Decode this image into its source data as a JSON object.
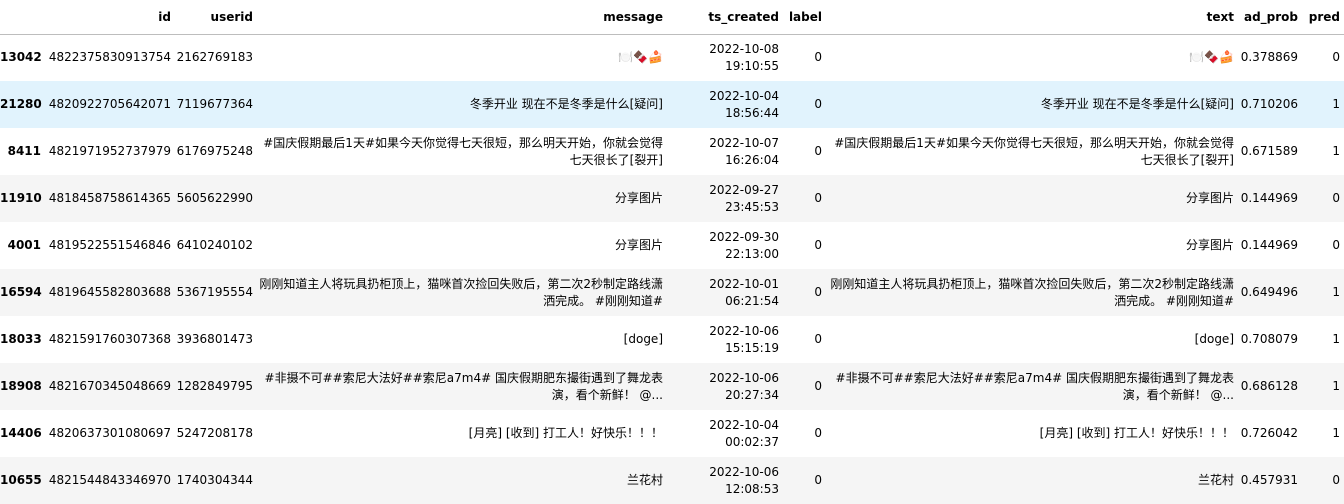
{
  "columns": [
    "",
    "id",
    "userid",
    "message",
    "ts_created",
    "label",
    "text",
    "ad_prob",
    "pred"
  ],
  "rows": [
    {
      "idx": "13042",
      "id": "4822375830913754",
      "userid": "2162769183",
      "message": "🍽️🍫🍰",
      "ts": "2022-10-08\n19:10:55",
      "label": "0",
      "text": "🍽️🍫🍰",
      "ad_prob": "0.378869",
      "pred": "0"
    },
    {
      "idx": "21280",
      "id": "4820922705642071",
      "userid": "7119677364",
      "message": "冬季开业 现在不是冬季是什么[疑问]",
      "ts": "2022-10-04\n18:56:44",
      "label": "0",
      "text": "冬季开业 现在不是冬季是什么[疑问]",
      "ad_prob": "0.710206",
      "pred": "1"
    },
    {
      "idx": "8411",
      "id": "4821971952737979",
      "userid": "6176975248",
      "message": "#国庆假期最后1天#如果今天你觉得七天很短，那么明天开始，你就会觉得七天很长了[裂开]",
      "ts": "2022-10-07\n16:26:04",
      "label": "0",
      "text": "#国庆假期最后1天#如果今天你觉得七天很短，那么明天开始，你就会觉得七天很长了[裂开]",
      "ad_prob": "0.671589",
      "pred": "1"
    },
    {
      "idx": "11910",
      "id": "4818458758614365",
      "userid": "5605622990",
      "message": "分享图片",
      "ts": "2022-09-27\n23:45:53",
      "label": "0",
      "text": "分享图片",
      "ad_prob": "0.144969",
      "pred": "0"
    },
    {
      "idx": "4001",
      "id": "4819522551546846",
      "userid": "6410240102",
      "message": "分享图片",
      "ts": "2022-09-30\n22:13:00",
      "label": "0",
      "text": "分享图片",
      "ad_prob": "0.144969",
      "pred": "0"
    },
    {
      "idx": "16594",
      "id": "4819645582803688",
      "userid": "5367195554",
      "message": "刚刚知道主人将玩具扔柜顶上，猫咪首次捡回失败后，第二次2秒制定路线潇洒完成。 #刚刚知道#",
      "ts": "2022-10-01\n06:21:54",
      "label": "0",
      "text": "刚刚知道主人将玩具扔柜顶上，猫咪首次捡回失败后，第二次2秒制定路线潇洒完成。 #刚刚知道#",
      "ad_prob": "0.649496",
      "pred": "1"
    },
    {
      "idx": "18033",
      "id": "4821591760307368",
      "userid": "3936801473",
      "message": "[doge]",
      "ts": "2022-10-06\n15:15:19",
      "label": "0",
      "text": "[doge]",
      "ad_prob": "0.708079",
      "pred": "1"
    },
    {
      "idx": "18908",
      "id": "4821670345048669",
      "userid": "1282849795",
      "message": "#非摄不可##索尼大法好##索尼a7m4# 国庆假期肥东撮街遇到了舞龙表演，看个新鲜！ @...",
      "ts": "2022-10-06\n20:27:34",
      "label": "0",
      "text": "#非摄不可##索尼大法好##索尼a7m4# 国庆假期肥东撮街遇到了舞龙表演，看个新鲜！ @...",
      "ad_prob": "0.686128",
      "pred": "1"
    },
    {
      "idx": "14406",
      "id": "4820637301080697",
      "userid": "5247208178",
      "message": "[月亮] [收到] 打工人！好快乐！！！",
      "ts": "2022-10-04\n00:02:37",
      "label": "0",
      "text": "[月亮] [收到] 打工人！好快乐！！！",
      "ad_prob": "0.726042",
      "pred": "1"
    },
    {
      "idx": "10655",
      "id": "4821544843346970",
      "userid": "1740304344",
      "message": "兰花村",
      "ts": "2022-10-06\n12:08:53",
      "label": "0",
      "text": "兰花村",
      "ad_prob": "0.457931",
      "pred": "0"
    }
  ]
}
